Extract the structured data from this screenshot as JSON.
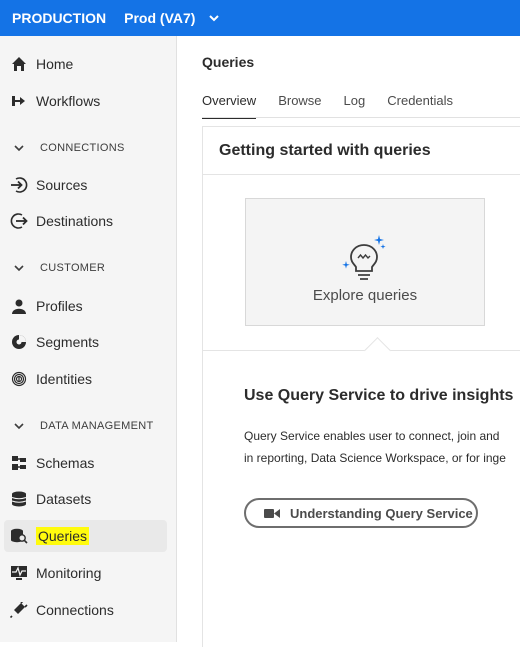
{
  "topbar": {
    "environment": "PRODUCTION",
    "sandbox": "Prod (VA7)"
  },
  "sidebar": {
    "items": [
      {
        "label": "Home",
        "icon": "home-icon"
      },
      {
        "label": "Workflows",
        "icon": "workflows-icon"
      },
      {
        "label": "Sources",
        "icon": "sources-icon"
      },
      {
        "label": "Destinations",
        "icon": "destinations-icon"
      },
      {
        "label": "Profiles",
        "icon": "profiles-icon"
      },
      {
        "label": "Segments",
        "icon": "segments-icon"
      },
      {
        "label": "Identities",
        "icon": "identities-icon"
      },
      {
        "label": "Schemas",
        "icon": "schemas-icon"
      },
      {
        "label": "Datasets",
        "icon": "datasets-icon"
      },
      {
        "label": "Queries",
        "icon": "queries-icon"
      },
      {
        "label": "Monitoring",
        "icon": "monitoring-icon"
      },
      {
        "label": "Connections",
        "icon": "connections-icon"
      }
    ],
    "sections": [
      "CONNECTIONS",
      "CUSTOMER",
      "DATA MANAGEMENT"
    ],
    "highlight_color": "#fffb0d"
  },
  "main": {
    "title": "Queries",
    "tabs": [
      "Overview",
      "Browse",
      "Log",
      "Credentials"
    ],
    "card_title": "Getting started with queries",
    "tile_label": "Explore queries",
    "promo_title": "Use Query Service to drive insights",
    "promo_line1": "Query Service enables user to connect, join and",
    "promo_line2": "in reporting, Data Science Workspace, or for inge",
    "cta_label": "Understanding Query Service"
  },
  "colors": {
    "brand": "#1473e6",
    "highlight": "#fffb0d"
  }
}
